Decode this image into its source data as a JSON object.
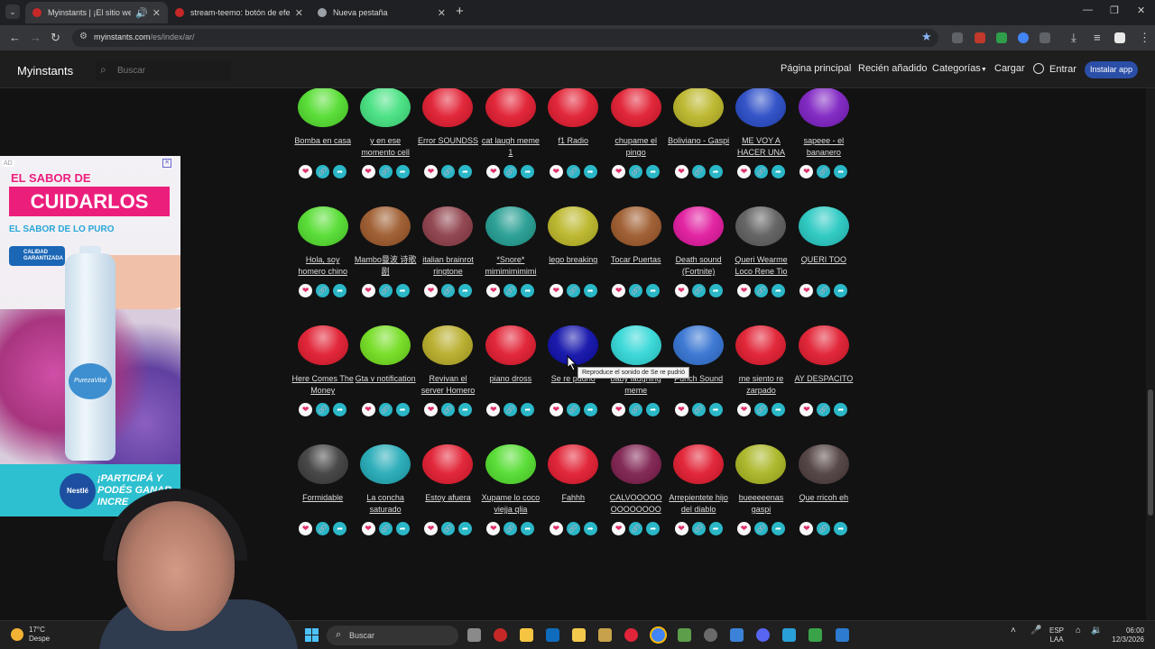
{
  "browser": {
    "tabs": [
      {
        "label": "Myinstants | ¡El sitio web de",
        "active": true,
        "icon_color": "#c62828"
      },
      {
        "label": "stream-teemo: botón de efecto",
        "active": false,
        "icon_color": "#c62828"
      },
      {
        "label": "Nueva pestaña",
        "active": false,
        "icon_color": "#9aa0a6"
      }
    ],
    "url_host": "myinstants.com",
    "url_path": "/es/index/ar/"
  },
  "header": {
    "logo": "Myinstants",
    "search_placeholder": "Buscar",
    "nav": {
      "home": "Página principal",
      "recent": "Recién añadido",
      "categories": "Categorías",
      "upload": "Cargar",
      "login": "Entrar",
      "install": "Instalar app"
    }
  },
  "sounds": [
    [
      {
        "name": "Bomba en casa",
        "color": "#4fdc2a"
      },
      {
        "name": "y en ese momento cell",
        "color": "#3fe07c"
      },
      {
        "name": "Error SOUNDSS",
        "color": "#e0172b"
      },
      {
        "name": "cat laugh meme 1",
        "color": "#e0172b"
      },
      {
        "name": "f1 Radio",
        "color": "#e0172b"
      },
      {
        "name": "chupame el pingo",
        "color": "#e0172b"
      },
      {
        "name": "Boliviano - Gaspi",
        "color": "#b9b423"
      },
      {
        "name": "ME VOY A HACER UNA",
        "color": "#2447c4"
      },
      {
        "name": "sapeee - el bananero",
        "color": "#7a1cc0"
      }
    ],
    [
      {
        "name": "Hola, soy homero chino",
        "color": "#4fdc2a"
      },
      {
        "name": "Mambo曼波 诗歌剧",
        "color": "#9a5526"
      },
      {
        "name": "italian brainrot ringtone",
        "color": "#8a3a45"
      },
      {
        "name": "*Snore* mimimimimimi",
        "color": "#1e9a8e"
      },
      {
        "name": "lego breaking",
        "color": "#b9b423"
      },
      {
        "name": "Tocar Puertas",
        "color": "#9a5526"
      },
      {
        "name": "Death sound (Fortnite)",
        "color": "#e0149c"
      },
      {
        "name": "Queri Wearme Loco Rene Tio",
        "color": "#5a5a5a"
      },
      {
        "name": "QUERI TOO",
        "color": "#23c7c0"
      }
    ],
    [
      {
        "name": "Here Comes The Money",
        "color": "#e0172b"
      },
      {
        "name": "Gta v notification",
        "color": "#6fdc1a"
      },
      {
        "name": "Revivan el server Homero",
        "color": "#b5aa23"
      },
      {
        "name": "piano dross",
        "color": "#e0172b"
      },
      {
        "name": "Se re pudrió",
        "color": "#0a0aa8"
      },
      {
        "name": "baby laughing meme",
        "color": "#2ed6d6"
      },
      {
        "name": "Punch Sound",
        "color": "#2f6fd0"
      },
      {
        "name": "me siento re zarpado",
        "color": "#e0172b"
      },
      {
        "name": "AY DESPACITO",
        "color": "#e0172b"
      }
    ],
    [
      {
        "name": "Formidable",
        "color": "#3a3a3a"
      },
      {
        "name": "La concha saturado",
        "color": "#1ea8b5"
      },
      {
        "name": "Estoy afuera",
        "color": "#e0172b"
      },
      {
        "name": "Xupame lo coco viejja qlia",
        "color": "#4fdc2a"
      },
      {
        "name": "Fahhh",
        "color": "#e0172b"
      },
      {
        "name": "CALVOOOOO OOOOOOOO",
        "color": "#7a1a4a"
      },
      {
        "name": "Arrepientete hijo del diablo",
        "color": "#e0172b"
      },
      {
        "name": "bueeeeenas gaspi",
        "color": "#a7b41e"
      },
      {
        "name": "Que rricoh eh",
        "color": "#4a3a3a"
      }
    ]
  ],
  "actions": {
    "favorite_icon": "heart-icon",
    "copy_icon": "link-icon",
    "share_icon": "share-icon"
  },
  "tooltip": "Reproduce el sonido de Se re pudrió",
  "ad": {
    "label": "AD",
    "line1": "EL SABOR DE",
    "line2": "CUIDARLOS",
    "line3": "EL SABOR DE LO PURO",
    "badge": "CALIDAD GARANTIZADA",
    "bottle_label": "PurezaVital",
    "pill": "Nestlé",
    "cta": "¡PARTICIPÁ Y PODÉS GANAR INCRE"
  },
  "taskbar": {
    "temp": "17°C",
    "weather_desc": "Despe",
    "search": "Buscar",
    "lang1": "ESP",
    "lang2": "LAA",
    "time": "06:00",
    "date": "12/3/2026"
  }
}
